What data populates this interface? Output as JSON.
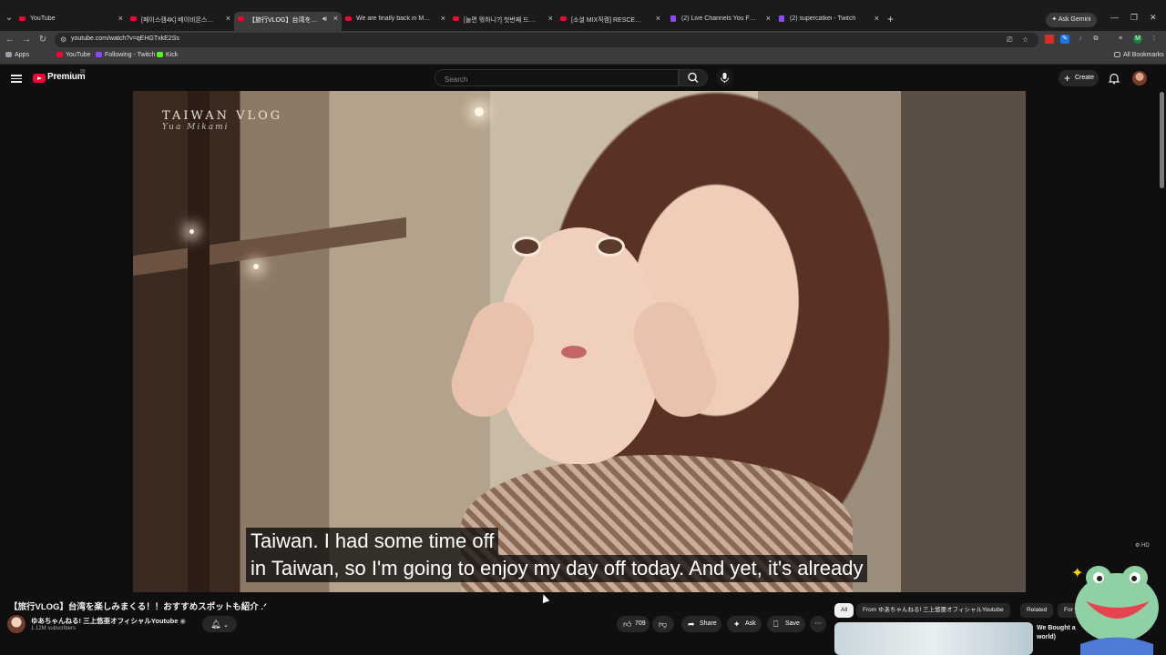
{
  "browser": {
    "tabs": [
      {
        "title": "YouTube",
        "active": false,
        "audio": false,
        "kind": "youtube"
      },
      {
        "title": "[페이스캠4K] 베이비몬스터 아",
        "active": false,
        "audio": false,
        "kind": "youtube"
      },
      {
        "title": "【旅行VLOG】台湾を楽しみま",
        "active": true,
        "audio": true,
        "kind": "youtube"
      },
      {
        "title": "We are finally back in Malaysia",
        "active": false,
        "audio": false,
        "kind": "youtube"
      },
      {
        "title": "[놀면 뭐하니?] 첫번째 드트리",
        "active": false,
        "audio": false,
        "kind": "youtube"
      },
      {
        "title": "[소셜 MIX직캠] RESCENE(리센",
        "active": false,
        "audio": false,
        "kind": "youtube"
      },
      {
        "title": "(2) Live Channels You Follow - T",
        "active": false,
        "audio": false,
        "kind": "twitch"
      },
      {
        "title": "(2) supercatkei - Twitch",
        "active": false,
        "audio": false,
        "kind": "twitch"
      }
    ],
    "gemini_label": "Ask Gemini",
    "url": "youtube.com/watch?v=qEHGTxkE2Ss",
    "bookmarks": [
      {
        "label": "Apps",
        "icon": "apps-grid-icon",
        "color": "#9aa0a6"
      },
      {
        "label": "YouTube",
        "icon": "youtube-icon",
        "color": "#ff0033"
      },
      {
        "label": "Following - Twitch",
        "icon": "twitch-icon",
        "color": "#9146ff"
      },
      {
        "label": "Kick",
        "icon": "kick-icon",
        "color": "#53fc18"
      }
    ],
    "all_bookmarks_label": "All Bookmarks"
  },
  "youtube": {
    "logo_text": "Premium",
    "logo_country": "90",
    "search_placeholder": "Search",
    "create_label": "Create",
    "accent": "#ff0033"
  },
  "video": {
    "watermark_title": "TAIWAN VLOG",
    "watermark_sub": "Yua Mikami",
    "caption_lines": [
      "Taiwan.   I had some time off",
      "in Taiwan, so I'm going to enjoy my day off today.  And yet, it's already"
    ],
    "title": "【旅行VLOG】台湾を楽しみまくる！！おすすめスポットも紹介 .ᐟ",
    "channel_name": "ゆあちゃんねる! 三上悠亜オフィシャルYoutube",
    "channel_subs": "1.12M subscribers",
    "likes": "709",
    "actions": {
      "share": "Share",
      "ask": "Ask",
      "save": "Save"
    }
  },
  "sidebar": {
    "chips": [
      "All",
      "From ゆあちゃんねる! 三上悠亜オフィシャルYoutube",
      "Related",
      "For y"
    ],
    "related_title": "We Bought a world)"
  }
}
